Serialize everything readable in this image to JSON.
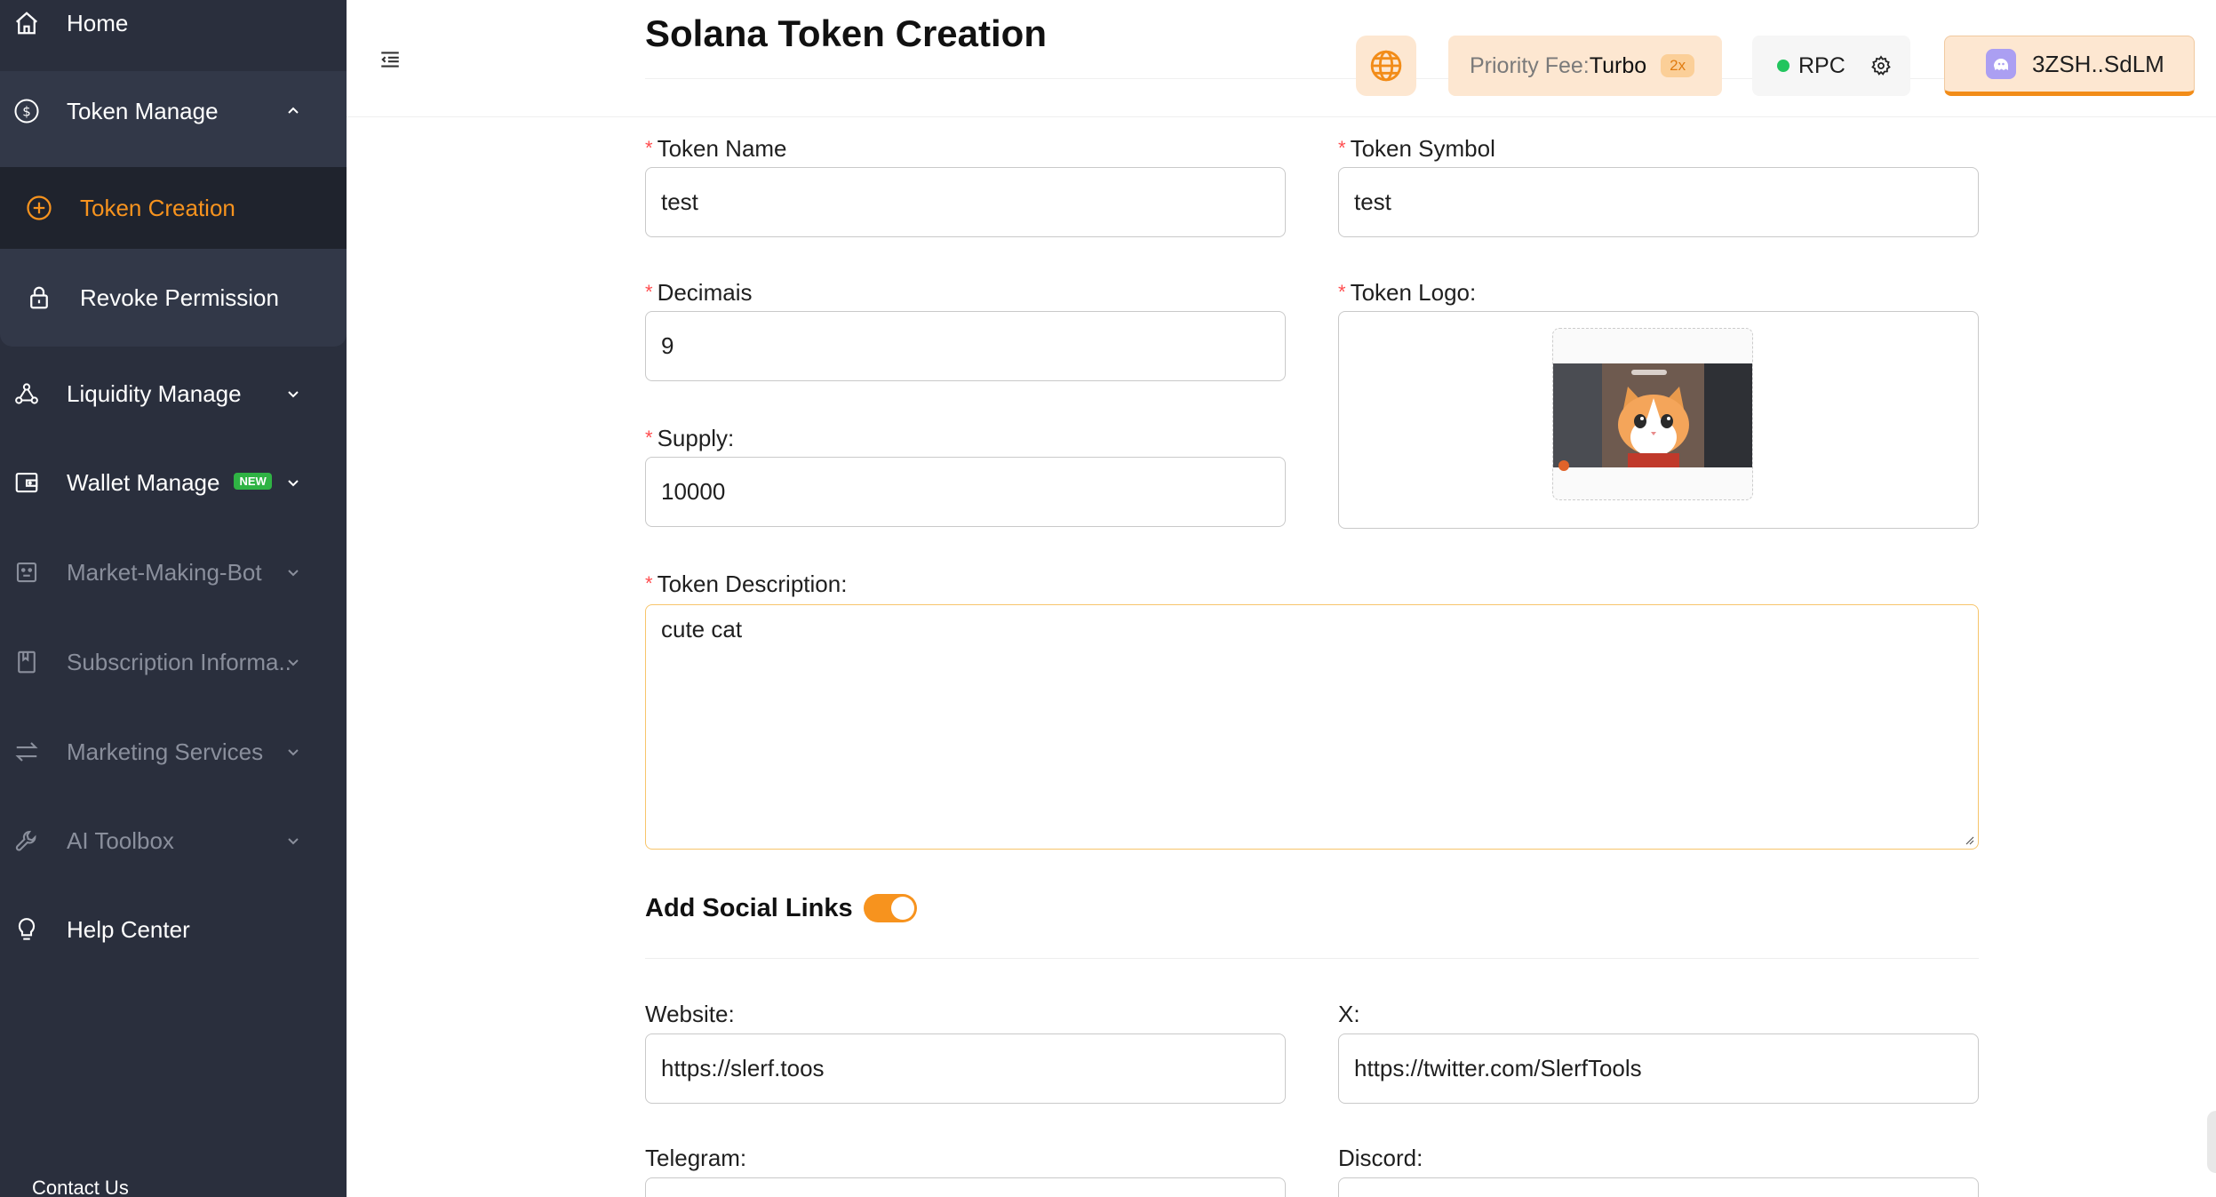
{
  "sidebar": {
    "home": "Home",
    "token_manage": "Token Manage",
    "token_creation": "Token Creation",
    "revoke_permission": "Revoke Permission",
    "liquidity_manage": "Liquidity Manage",
    "wallet_manage": "Wallet Manage",
    "wallet_badge": "NEW",
    "market_making_bot": "Market-Making-Bot",
    "subscription": "Subscription Informa..",
    "marketing_services": "Marketing Services",
    "ai_toolbox": "AI Toolbox",
    "help_center": "Help Center",
    "contact": "Contact Us"
  },
  "header": {
    "title": "Solana Token Creation",
    "priority_label": "Priority Fee:",
    "priority_value": "Turbo",
    "priority_multiplier": "2x",
    "rpc_label": "RPC",
    "rpc_status_color": "#22c55e",
    "wallet_address": "3ZSH..SdLM"
  },
  "form": {
    "token_name_label": "Token Name",
    "token_name_value": "test",
    "token_symbol_label": "Token Symbol",
    "token_symbol_value": "test",
    "decimals_label": "Decimais",
    "decimals_value": "9",
    "token_logo_label": "Token Logo:",
    "supply_label": "Supply:",
    "supply_value": "10000",
    "description_label": "Token Description:",
    "description_value": "cute cat",
    "social_title": "Add Social Links",
    "social_enabled": true,
    "website_label": "Website:",
    "website_value": "https://slerf.toos",
    "x_label": "X:",
    "x_value": "https://twitter.com/SlerfTools",
    "telegram_label": "Telegram:",
    "discord_label": "Discord:"
  },
  "colors": {
    "sidebar_bg": "#2a2f3d",
    "accent": "#f7931e",
    "required": "#ff4d4f"
  }
}
